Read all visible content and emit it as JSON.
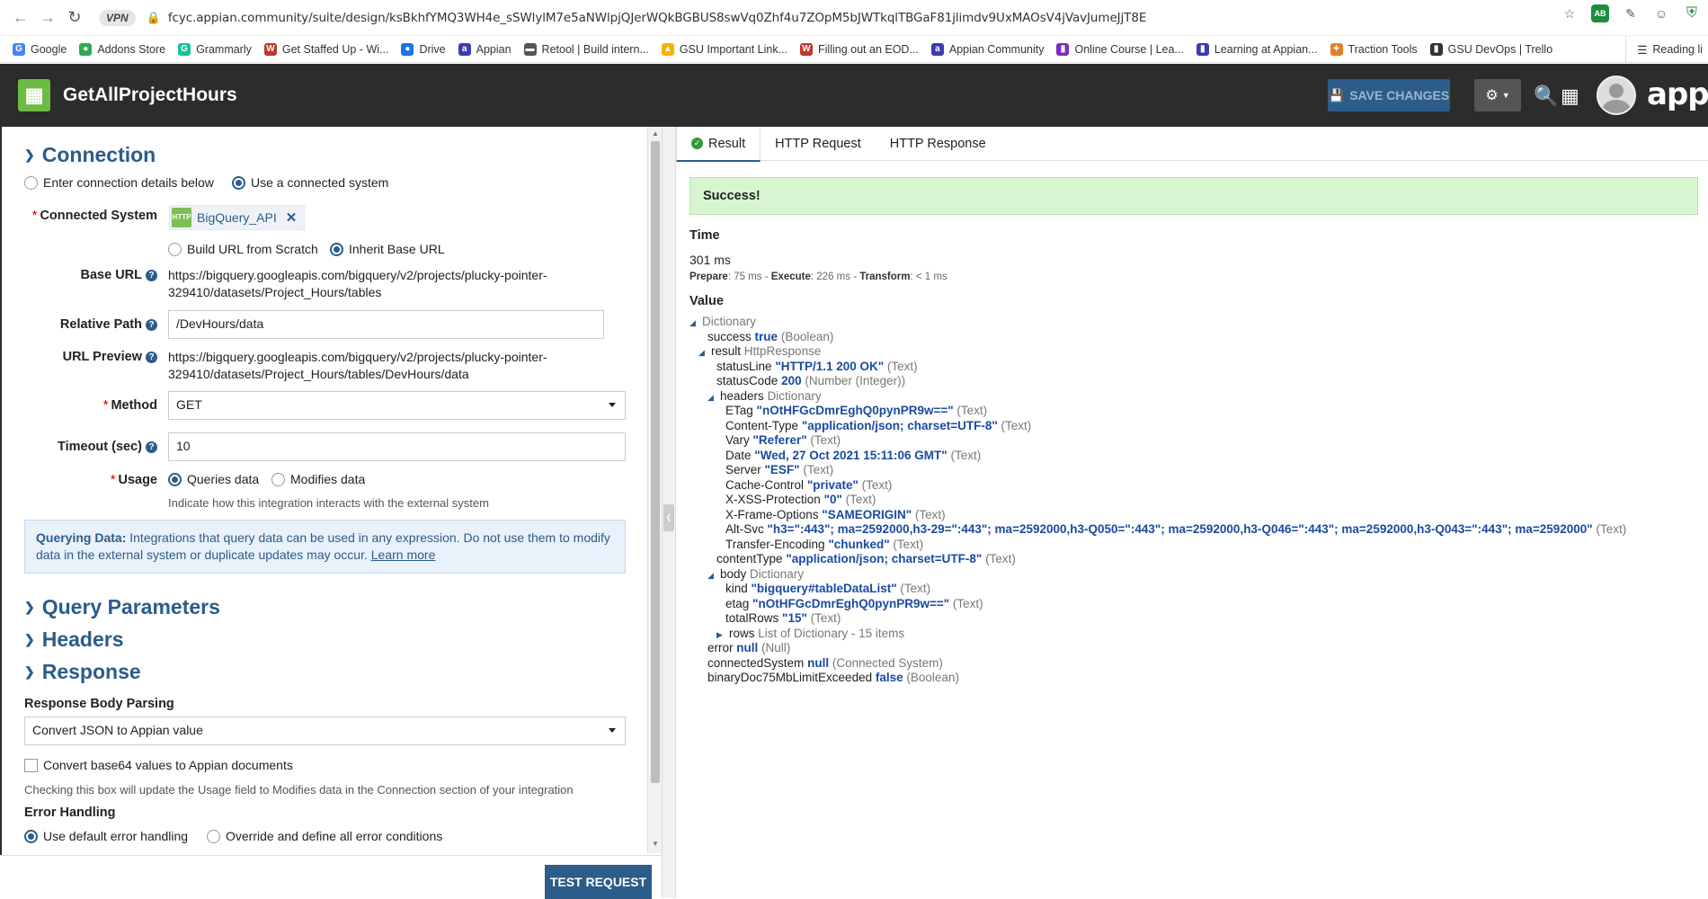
{
  "browser": {
    "vpn_label": "VPN",
    "url": "fcyc.appian.community/suite/design/ksBkhfYMQ3WH4e_sSWlylM7e5aNWlpjQJerWQkBGBUS8swVq0Zhf4u7ZOpM5bJWTkqlTBGaF81jlimdv9UxMAOsV4jVavJumeJjT8E",
    "bookmarks": [
      "Google",
      "Addons Store",
      "Grammarly",
      "Get Staffed Up - Wi...",
      "Drive",
      "Appian",
      "Retool | Build intern...",
      "GSU Important Link...",
      "Filling out an EOD...",
      "Appian Community",
      "Online Course | Lea...",
      "Learning at Appian...",
      "Traction Tools",
      "GSU DevOps | Trello"
    ],
    "reading_list": "Reading li",
    "ext_badge": "AB"
  },
  "header": {
    "title": "GetAllProjectHours",
    "save_label": "SAVE CHANGES",
    "brand": "appian"
  },
  "connection": {
    "section_title": "Connection",
    "radio_enter": "Enter connection details below",
    "radio_use": "Use a connected system",
    "connected_system_label": "Connected System",
    "connected_system_value": "BigQuery_API",
    "chip_icon_text": "HTTP",
    "radio_build": "Build URL from Scratch",
    "radio_inherit": "Inherit Base URL",
    "base_url_label": "Base URL",
    "base_url_line1": "https://bigquery.googleapis.com/bigquery/v2/projects/plucky-pointer-",
    "base_url_line2": "329410/datasets/Project_Hours/tables",
    "relative_path_label": "Relative Path",
    "relative_path_value": "/DevHours/data",
    "url_preview_label": "URL Preview",
    "url_preview_line1": "https://bigquery.googleapis.com/bigquery/v2/projects/plucky-pointer-",
    "url_preview_line2": "329410/datasets/Project_Hours/tables/DevHours/data",
    "method_label": "Method",
    "method_value": "GET",
    "timeout_label": "Timeout (sec)",
    "timeout_value": "10",
    "usage_label": "Usage",
    "usage_queries": "Queries data",
    "usage_modifies": "Modifies data",
    "usage_hint": "Indicate how this integration interacts with the external system",
    "info_bold": "Querying Data:",
    "info_text": " Integrations that query data can be used in any expression. Do not use them to modify data in the external system or duplicate updates may occur. ",
    "info_link": "Learn more"
  },
  "sections": {
    "query_params": "Query Parameters",
    "headers": "Headers",
    "response": "Response"
  },
  "response": {
    "body_parsing_label": "Response Body Parsing",
    "body_parsing_value": "Convert JSON to Appian value",
    "base64_label": "Convert base64 values to Appian documents",
    "base64_hint": "Checking this box will update the Usage field to Modifies data in the Connection section of your integration",
    "error_label": "Error Handling",
    "error_default": "Use default error handling",
    "error_override": "Override and define all error conditions"
  },
  "footer": {
    "test_label": "TEST REQUEST"
  },
  "result_tabs": [
    "Result",
    "HTTP Request",
    "HTTP Response"
  ],
  "result": {
    "banner": "Success!",
    "time_label": "Time",
    "time_value": "301 ms",
    "prepare_label": "Prepare",
    "prepare_value": ": 75 ms - ",
    "execute_label": "Execute",
    "execute_value": ": 226 ms - ",
    "transform_label": "Transform",
    "transform_value": ": < 1 ms",
    "value_label": "Value"
  },
  "tree": [
    {
      "key": "Dictionary",
      "val": "",
      "type": "",
      "depth": 0,
      "expand": true,
      "keyStyle": "dict"
    },
    {
      "key": "success",
      "val": "true",
      "type": "(Boolean)",
      "depth": 1,
      "expand": false
    },
    {
      "key": "result",
      "val": "",
      "type": "HttpResponse",
      "depth": 1,
      "expand": true
    },
    {
      "key": "statusLine",
      "val": "\"HTTP/1.1 200 OK\"",
      "type": "(Text)",
      "depth": 2,
      "expand": false
    },
    {
      "key": "statusCode",
      "val": "200",
      "type": "(Number (Integer))",
      "depth": 2,
      "expand": false
    },
    {
      "key": "headers",
      "val": "",
      "type": "Dictionary",
      "depth": 2,
      "expand": true
    },
    {
      "key": "ETag",
      "val": "\"nOtHFGcDmrEghQ0pynPR9w==\"",
      "type": "(Text)",
      "depth": 3,
      "expand": false
    },
    {
      "key": "Content-Type",
      "val": "\"application/json; charset=UTF-8\"",
      "type": "(Text)",
      "depth": 3,
      "expand": false
    },
    {
      "key": "Vary",
      "val": "\"Referer\"",
      "type": "(Text)",
      "depth": 3,
      "expand": false
    },
    {
      "key": "Date",
      "val": "\"Wed, 27 Oct 2021 15:11:06 GMT\"",
      "type": "(Text)",
      "depth": 3,
      "expand": false
    },
    {
      "key": "Server",
      "val": "\"ESF\"",
      "type": "(Text)",
      "depth": 3,
      "expand": false
    },
    {
      "key": "Cache-Control",
      "val": "\"private\"",
      "type": "(Text)",
      "depth": 3,
      "expand": false
    },
    {
      "key": "X-XSS-Protection",
      "val": "\"0\"",
      "type": "(Text)",
      "depth": 3,
      "expand": false
    },
    {
      "key": "X-Frame-Options",
      "val": "\"SAMEORIGIN\"",
      "type": "(Text)",
      "depth": 3,
      "expand": false
    },
    {
      "key": "Alt-Svc",
      "val": "\"h3=\":443\"; ma=2592000,h3-29=\":443\"; ma=2592000,h3-Q050=\":443\"; ma=2592000,h3-Q046=\":443\"; ma=2592000,h3-Q043=\":443\"; ma=2592000\"",
      "type": "(Text)",
      "depth": 3,
      "expand": false
    },
    {
      "key": "Transfer-Encoding",
      "val": "\"chunked\"",
      "type": "(Text)",
      "depth": 3,
      "expand": false
    },
    {
      "key": "contentType",
      "val": "\"application/json; charset=UTF-8\"",
      "type": "(Text)",
      "depth": 2,
      "expand": false
    },
    {
      "key": "body",
      "val": "",
      "type": "Dictionary",
      "depth": 2,
      "expand": true
    },
    {
      "key": "kind",
      "val": "\"bigquery#tableDataList\"",
      "type": "(Text)",
      "depth": 3,
      "expand": false
    },
    {
      "key": "etag",
      "val": "\"nOtHFGcDmrEghQ0pynPR9w==\"",
      "type": "(Text)",
      "depth": 3,
      "expand": false
    },
    {
      "key": "totalRows",
      "val": "\"15\"",
      "type": "(Text)",
      "depth": 3,
      "expand": false
    },
    {
      "key": "rows",
      "val": "",
      "type": "List of Dictionary - 15 items",
      "depth": 3,
      "expand": "collapsed"
    },
    {
      "key": "error",
      "val": "null",
      "type": "(Null)",
      "depth": 1,
      "expand": false
    },
    {
      "key": "connectedSystem",
      "val": "null",
      "type": "(Connected System)",
      "depth": 1,
      "expand": false
    },
    {
      "key": "binaryDoc75MbLimitExceeded",
      "val": "false",
      "type": "(Boolean)",
      "depth": 1,
      "expand": false
    }
  ]
}
